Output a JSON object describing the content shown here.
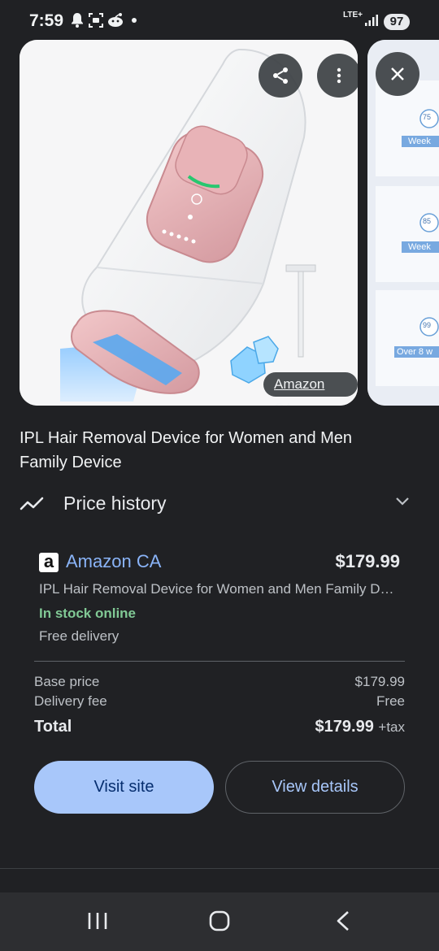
{
  "status_bar": {
    "time": "7:59",
    "network_label": "LTE+",
    "battery": "97",
    "icons": [
      "notification-bell-icon",
      "screenshot-icon",
      "reddit-icon",
      "dot-icon",
      "signal-icon"
    ]
  },
  "gallery": {
    "source_chip": "Amazon CA",
    "actions": [
      "share-icon",
      "more-vert-icon",
      "close-icon"
    ],
    "next_image_labels": [
      "Week",
      "Week",
      "Over 8 w"
    ],
    "next_image_badges": [
      "75",
      "85",
      "99"
    ]
  },
  "product": {
    "title": "IPL Hair Removal Device for Women and Men Family Device"
  },
  "price_history": {
    "label": "Price history",
    "icon": "trending-icon"
  },
  "offer": {
    "merchant": "Amazon CA",
    "merchant_logo": "a",
    "price": "$179.99",
    "listing_title": "IPL Hair Removal Device for Women and Men Family Device",
    "stock": "In stock online",
    "delivery": "Free delivery",
    "base_price_label": "Base price",
    "base_price_value": "$179.99",
    "delivery_fee_label": "Delivery fee",
    "delivery_fee_value": "Free",
    "total_label": "Total",
    "total_value": "$179.99",
    "tax_suffix": "+tax",
    "primary_button": "Visit site",
    "secondary_button": "View details",
    "colors": {
      "accent": "#8ab4f8",
      "in_stock": "#81c995",
      "primary_button_bg": "#a8c7fa"
    }
  },
  "nav_bar": {
    "buttons": [
      "recents-icon",
      "home-icon",
      "back-icon"
    ]
  }
}
